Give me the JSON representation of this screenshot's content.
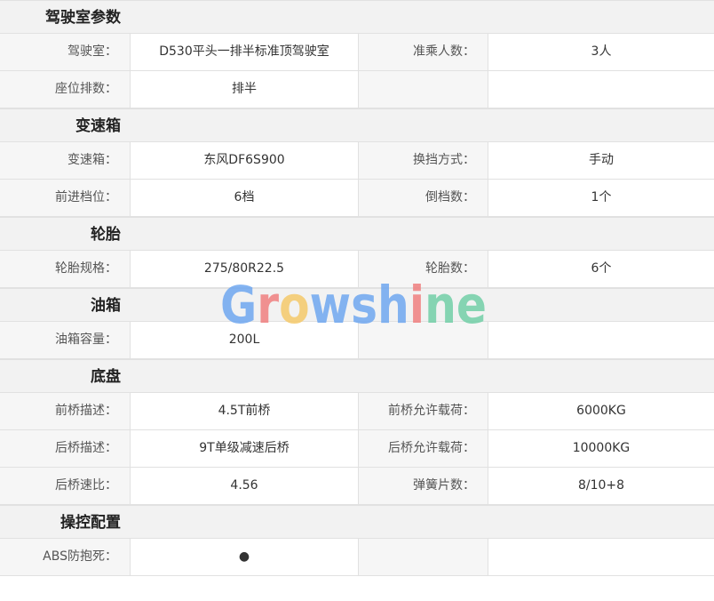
{
  "sections": [
    {
      "title": "驾驶室参数",
      "rows": [
        {
          "label1": "驾驶室：",
          "value1": "D530平头一排半标准顶驾驶室",
          "label2": "准乘人数：",
          "value2": "3人"
        },
        {
          "label1": "座位排数：",
          "value1": "排半",
          "label2": "",
          "value2": ""
        }
      ]
    },
    {
      "title": "变速箱",
      "rows": [
        {
          "label1": "变速箱：",
          "value1": "东风DF6S900",
          "label2": "换挡方式：",
          "value2": "手动"
        },
        {
          "label1": "前进档位：",
          "value1": "6档",
          "label2": "倒档数：",
          "value2": "1个"
        }
      ]
    },
    {
      "title": "轮胎",
      "rows": [
        {
          "label1": "轮胎规格：",
          "value1": "275/80R22.5",
          "label2": "轮胎数：",
          "value2": "6个"
        }
      ]
    },
    {
      "title": "油箱",
      "rows": [
        {
          "label1": "油箱容量：",
          "value1": "200L",
          "label2": "",
          "value2": ""
        }
      ]
    },
    {
      "title": "底盘",
      "rows": [
        {
          "label1": "前桥描述：",
          "value1": "4.5T前桥",
          "label2": "前桥允许载荷：",
          "value2": "6000KG"
        },
        {
          "label1": "后桥描述：",
          "value1": "9T单级减速后桥",
          "label2": "后桥允许载荷：",
          "value2": "10000KG"
        },
        {
          "label1": "后桥速比：",
          "value1": "4.56",
          "label2": "弹簧片数：",
          "value2": "8/10+8"
        }
      ]
    },
    {
      "title": "操控配置",
      "rows": [
        {
          "label1": "ABS防抱死：",
          "value1": "●",
          "label2": "",
          "value2": ""
        }
      ]
    }
  ],
  "watermark": {
    "text": "Growshine",
    "letters": [
      "G",
      "r",
      "o",
      "w",
      "s",
      "h",
      "i",
      "n",
      "e"
    ],
    "colors": [
      "#6fa7f0",
      "#f07f7f",
      "#f5c96a",
      "#6fa7f0",
      "#6fa7f0",
      "#6fa7f0",
      "#f07f7f",
      "#72cfa7",
      "#72cfa7"
    ]
  }
}
